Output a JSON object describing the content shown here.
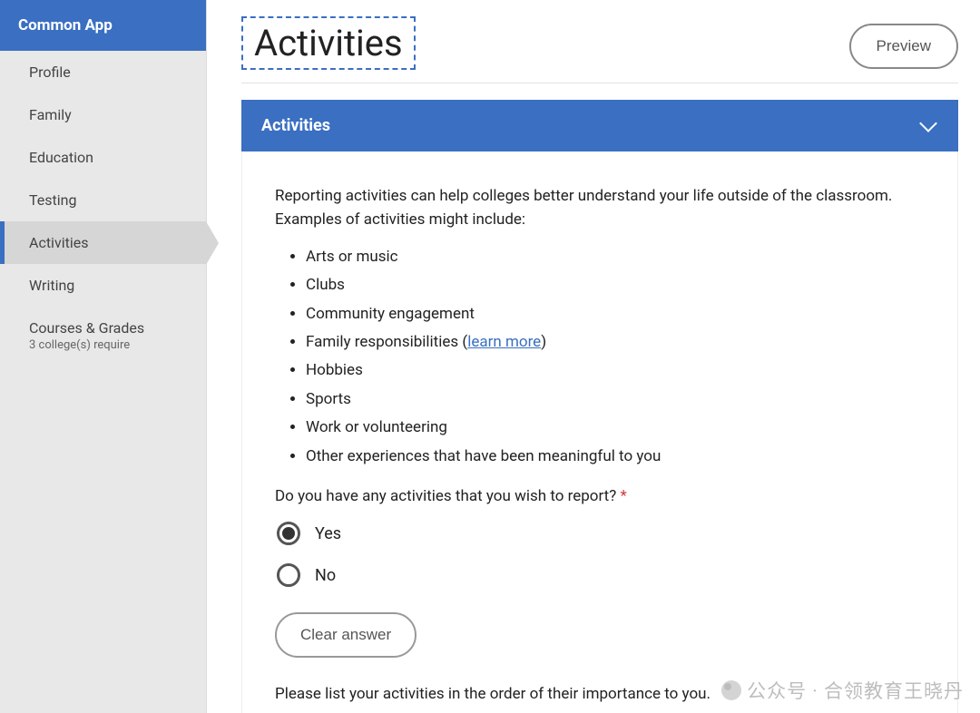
{
  "sidebar": {
    "header": "Common App",
    "items": [
      {
        "label": "Profile"
      },
      {
        "label": "Family"
      },
      {
        "label": "Education"
      },
      {
        "label": "Testing"
      },
      {
        "label": "Activities"
      },
      {
        "label": "Writing"
      },
      {
        "label": "Courses & Grades",
        "sub": "3 college(s) require"
      }
    ]
  },
  "header": {
    "title": "Activities",
    "preview_label": "Preview"
  },
  "section": {
    "title": "Activities",
    "intro": "Reporting activities can help colleges better understand your life outside of the classroom. Examples of activities might include:",
    "examples_pre": "Family responsibilities (",
    "learn_more": "learn more",
    "examples_post": ")",
    "examples": [
      "Arts or music",
      "Clubs",
      "Community engagement",
      "Hobbies",
      "Sports",
      "Work or volunteering",
      "Other experiences that have been meaningful to you"
    ],
    "question": "Do you have any activities that you wish to report?",
    "required_marker": "*",
    "options": {
      "yes": "Yes",
      "no": "No"
    },
    "selected": "yes",
    "clear_label": "Clear answer",
    "order_text": "Please list your activities in the order of their importance to you."
  },
  "watermark": "公众号 · 合领教育王晓丹"
}
